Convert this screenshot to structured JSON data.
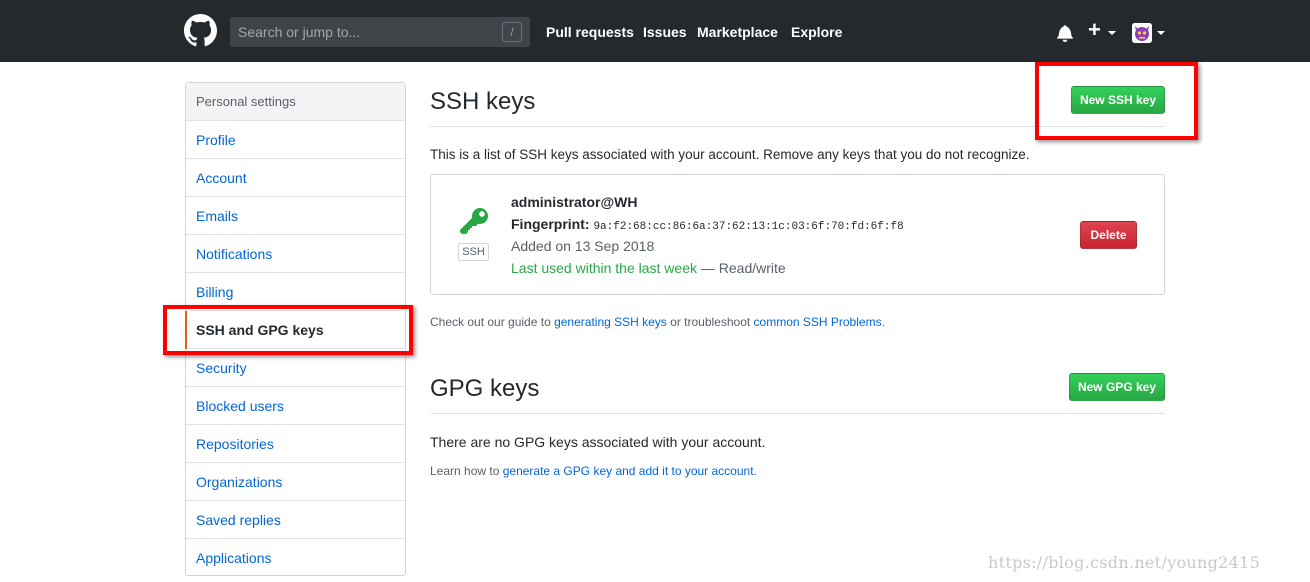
{
  "header": {
    "search_placeholder": "Search or jump to...",
    "search_shortcut": "/",
    "nav": [
      "Pull requests",
      "Issues",
      "Marketplace",
      "Explore"
    ],
    "plus_label": "+",
    "logo_icon": "github-octocat-icon",
    "bell_icon": "bell-icon",
    "avatar_icon": "avatar"
  },
  "sidebar": {
    "heading": "Personal settings",
    "items": [
      {
        "label": "Profile"
      },
      {
        "label": "Account"
      },
      {
        "label": "Emails"
      },
      {
        "label": "Notifications"
      },
      {
        "label": "Billing"
      },
      {
        "label": "SSH and GPG keys",
        "selected": true
      },
      {
        "label": "Security"
      },
      {
        "label": "Blocked users"
      },
      {
        "label": "Repositories"
      },
      {
        "label": "Organizations"
      },
      {
        "label": "Saved replies"
      },
      {
        "label": "Applications"
      }
    ]
  },
  "ssh": {
    "title": "SSH keys",
    "new_button": "New SSH key",
    "description": "This is a list of SSH keys associated with your account. Remove any keys that you do not recognize.",
    "key": {
      "name": "administrator@WH",
      "fingerprint_label": "Fingerprint:",
      "fingerprint": "9a:f2:68:cc:86:6a:37:62:13:1c:03:6f:70:fd:6f:f8",
      "added": "Added on 13 Sep 2018",
      "last_used": "Last used within the last week",
      "access": " — Read/write",
      "tag": "SSH",
      "delete_button": "Delete"
    },
    "guide": {
      "prefix": "Check out our guide to ",
      "link1": "generating SSH keys",
      "middle": " or troubleshoot ",
      "link2": "common SSH Problems",
      "suffix": "."
    }
  },
  "gpg": {
    "title": "GPG keys",
    "new_button": "New GPG key",
    "empty": "There are no GPG keys associated with your account.",
    "learn": {
      "prefix": "Learn how to ",
      "link": "generate a GPG key and add it to your account",
      "suffix": "."
    }
  },
  "watermark": "https://blog.csdn.net/young2415",
  "colors": {
    "header_bg": "#24292e",
    "link": "#0366d6",
    "green": "#28a745",
    "red": "#cb2431",
    "highlight": "#ff0000",
    "selected_bar": "#e36209"
  }
}
